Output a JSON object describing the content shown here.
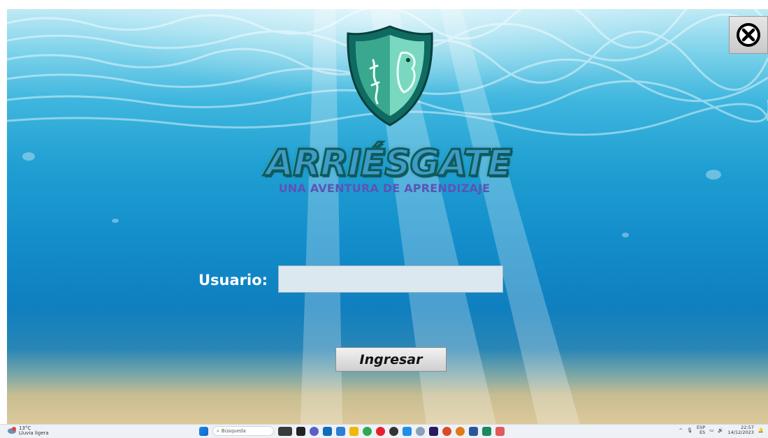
{
  "app": {
    "title": "ARRIÉSGATE",
    "subtitle": "UNA AVENTURA DE APRENDIZAJE",
    "close_icon": "circle-x-icon",
    "logo_icon": "shield-emblem-icon"
  },
  "login": {
    "user_label": "Usuario:",
    "user_value": "",
    "submit_label": "Ingresar"
  },
  "taskbar": {
    "weather_temp": "13°C",
    "weather_desc": "Lluvia ligera",
    "search_placeholder": "Búsqueda",
    "tray_lang": "ESP",
    "tray_region": "ES",
    "time": "22:57",
    "date": "14/12/2023"
  },
  "colors": {
    "title_fill": "#3e9bc6",
    "title_outline": "#0f5a5c",
    "subtitle": "#5b54b6",
    "input_bg": "#dbe8ef"
  }
}
